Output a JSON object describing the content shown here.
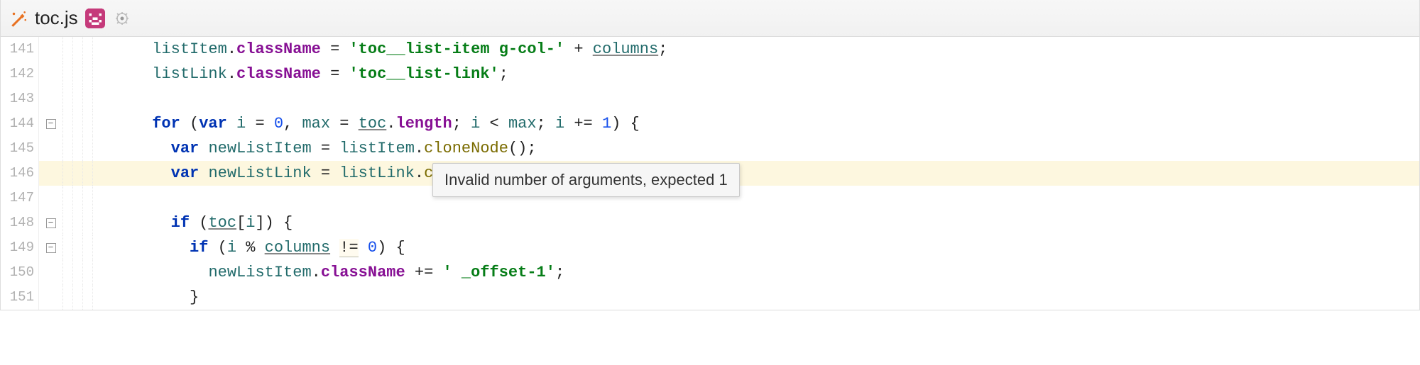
{
  "tab": {
    "filename": "toc.js"
  },
  "tooltip": {
    "message": "Invalid number of arguments, expected 1"
  },
  "lines": [
    {
      "num": 141,
      "fold": "",
      "indent": 3,
      "tokens": [
        {
          "t": "id",
          "v": "listItem"
        },
        {
          "t": "op",
          "v": "."
        },
        {
          "t": "prop",
          "v": "className"
        },
        {
          "t": "op",
          "v": " = "
        },
        {
          "t": "str",
          "v": "'toc__list-item g-col-'"
        },
        {
          "t": "op",
          "v": " + "
        },
        {
          "t": "id ul",
          "v": "columns"
        },
        {
          "t": "op",
          "v": ";"
        }
      ]
    },
    {
      "num": 142,
      "fold": "",
      "indent": 3,
      "tokens": [
        {
          "t": "id",
          "v": "listLink"
        },
        {
          "t": "op",
          "v": "."
        },
        {
          "t": "prop",
          "v": "className"
        },
        {
          "t": "op",
          "v": " = "
        },
        {
          "t": "str",
          "v": "'toc__list-link'"
        },
        {
          "t": "op",
          "v": ";"
        }
      ]
    },
    {
      "num": 143,
      "fold": "",
      "indent": 0,
      "tokens": []
    },
    {
      "num": 144,
      "fold": "-",
      "indent": 3,
      "tokens": [
        {
          "t": "kw",
          "v": "for"
        },
        {
          "t": "op",
          "v": " ("
        },
        {
          "t": "kw",
          "v": "var"
        },
        {
          "t": "op",
          "v": " "
        },
        {
          "t": "id",
          "v": "i"
        },
        {
          "t": "op",
          "v": " = "
        },
        {
          "t": "num",
          "v": "0"
        },
        {
          "t": "op",
          "v": ", "
        },
        {
          "t": "id",
          "v": "max"
        },
        {
          "t": "op",
          "v": " = "
        },
        {
          "t": "id ul",
          "v": "toc"
        },
        {
          "t": "op",
          "v": "."
        },
        {
          "t": "prop",
          "v": "length"
        },
        {
          "t": "op",
          "v": "; "
        },
        {
          "t": "id",
          "v": "i"
        },
        {
          "t": "op",
          "v": " < "
        },
        {
          "t": "id",
          "v": "max"
        },
        {
          "t": "op",
          "v": "; "
        },
        {
          "t": "id",
          "v": "i"
        },
        {
          "t": "op",
          "v": " += "
        },
        {
          "t": "num",
          "v": "1"
        },
        {
          "t": "op",
          "v": ") {"
        }
      ]
    },
    {
      "num": 145,
      "fold": "",
      "indent": 4,
      "tokens": [
        {
          "t": "kw",
          "v": "var"
        },
        {
          "t": "op",
          "v": " "
        },
        {
          "t": "id",
          "v": "newListItem"
        },
        {
          "t": "op",
          "v": " = "
        },
        {
          "t": "id",
          "v": "listItem"
        },
        {
          "t": "op",
          "v": "."
        },
        {
          "t": "fn",
          "v": "cloneNode"
        },
        {
          "t": "op",
          "v": "();"
        }
      ]
    },
    {
      "num": 146,
      "fold": "",
      "indent": 4,
      "hl": true,
      "tokens": [
        {
          "t": "kw",
          "v": "var"
        },
        {
          "t": "op",
          "v": " "
        },
        {
          "t": "id",
          "v": "newListLink"
        },
        {
          "t": "op",
          "v": " = "
        },
        {
          "t": "id",
          "v": "listLink"
        },
        {
          "t": "op",
          "v": "."
        },
        {
          "t": "fn",
          "v": "cloneNode"
        },
        {
          "t": "sel",
          "v": "()"
        },
        {
          "t": "op",
          "v": ";"
        }
      ]
    },
    {
      "num": 147,
      "fold": "",
      "indent": 0,
      "tokens": []
    },
    {
      "num": 148,
      "fold": "-",
      "indent": 4,
      "tokens": [
        {
          "t": "kw",
          "v": "if"
        },
        {
          "t": "op",
          "v": " ("
        },
        {
          "t": "id ul",
          "v": "toc"
        },
        {
          "t": "op",
          "v": "["
        },
        {
          "t": "id",
          "v": "i"
        },
        {
          "t": "op",
          "v": "]) {"
        }
      ]
    },
    {
      "num": 149,
      "fold": "-",
      "indent": 5,
      "tokens": [
        {
          "t": "kw",
          "v": "if"
        },
        {
          "t": "op",
          "v": " ("
        },
        {
          "t": "id",
          "v": "i"
        },
        {
          "t": "op",
          "v": " % "
        },
        {
          "t": "id ul",
          "v": "columns"
        },
        {
          "t": "op",
          "v": " "
        },
        {
          "t": "op warn-ul",
          "v": "!="
        },
        {
          "t": "op",
          "v": " "
        },
        {
          "t": "num",
          "v": "0"
        },
        {
          "t": "op",
          "v": ") {"
        }
      ]
    },
    {
      "num": 150,
      "fold": "",
      "indent": 6,
      "tokens": [
        {
          "t": "id",
          "v": "newListItem"
        },
        {
          "t": "op",
          "v": "."
        },
        {
          "t": "prop",
          "v": "className"
        },
        {
          "t": "op",
          "v": " += "
        },
        {
          "t": "str",
          "v": "' _offset-1'"
        },
        {
          "t": "op",
          "v": ";"
        }
      ]
    },
    {
      "num": 151,
      "fold": "",
      "indent": 5,
      "tokens": [
        {
          "t": "op",
          "v": "}"
        }
      ]
    }
  ]
}
